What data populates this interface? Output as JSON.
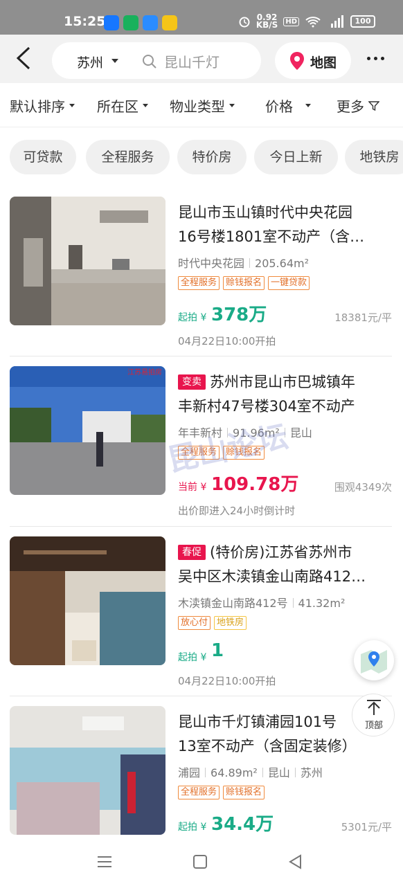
{
  "status_bar": {
    "time": "15:25",
    "net_speed": "0.92\nKB/S",
    "battery": "100"
  },
  "header": {
    "city": "苏州",
    "search_text": "昆山千灯",
    "map_label": "地图"
  },
  "filters": [
    "默认排序",
    "所在区",
    "物业类型",
    "价格",
    "更多"
  ],
  "chips": [
    "可贷款",
    "全程服务",
    "特价房",
    "今日上新",
    "地铁房"
  ],
  "listings": [
    {
      "title_line1": "昆山市玉山镇时代中央花园",
      "title_line2": "16号楼1801室不动产（含…",
      "community": "时代中央花园",
      "area": "205.64m²",
      "tags": [
        "全程服务",
        "赊钱报名",
        "一键贷款"
      ],
      "price_prefix": "起拍 ¥",
      "price": "378万",
      "side": "18381元/平",
      "footnote": "04月22日10:00开拍"
    },
    {
      "badge": "变卖",
      "title_line1": "苏州市昆山市巴城镇年",
      "title_line2": "丰新村47号楼304室不动产",
      "community": "年丰新村",
      "area": "91.96m²",
      "district": "昆山",
      "tags": [
        "全程服务",
        "赊钱报名"
      ],
      "price_prefix": "当前 ¥",
      "price": "109.78万",
      "side": "围观4349次",
      "footnote": "出价即进入24小时倒计时"
    },
    {
      "badge": "春促",
      "title_line1": "(特价房)江苏省苏州市",
      "title_line2": "吴中区木渎镇金山南路412…",
      "community": "木渎镇金山南路412号",
      "area": "41.32m²",
      "tags": [
        "放心付",
        "地铁房"
      ],
      "price_prefix": "起拍 ¥",
      "price": "1",
      "footnote": "04月22日10:00开拍"
    },
    {
      "title_line1": "昆山市千灯镇浦园101号",
      "title_line2": "13室不动产（含固定装修）",
      "community": "浦园",
      "area": "64.89m²",
      "district": "昆山",
      "city": "苏州",
      "tags": [
        "全程服务",
        "赊钱报名"
      ],
      "price_prefix": "起拍 ¥",
      "price": "34.4万",
      "side": "5301元/平"
    }
  ],
  "floating": {
    "top_label": "顶部"
  },
  "watermark": "昆山论坛",
  "photo_badge": "江苏易拍房",
  "colors": {
    "accent_green": "#1aab87",
    "accent_red": "#e8154d",
    "tag_orange": "#e2702a",
    "badge_red": "#e8154d"
  }
}
